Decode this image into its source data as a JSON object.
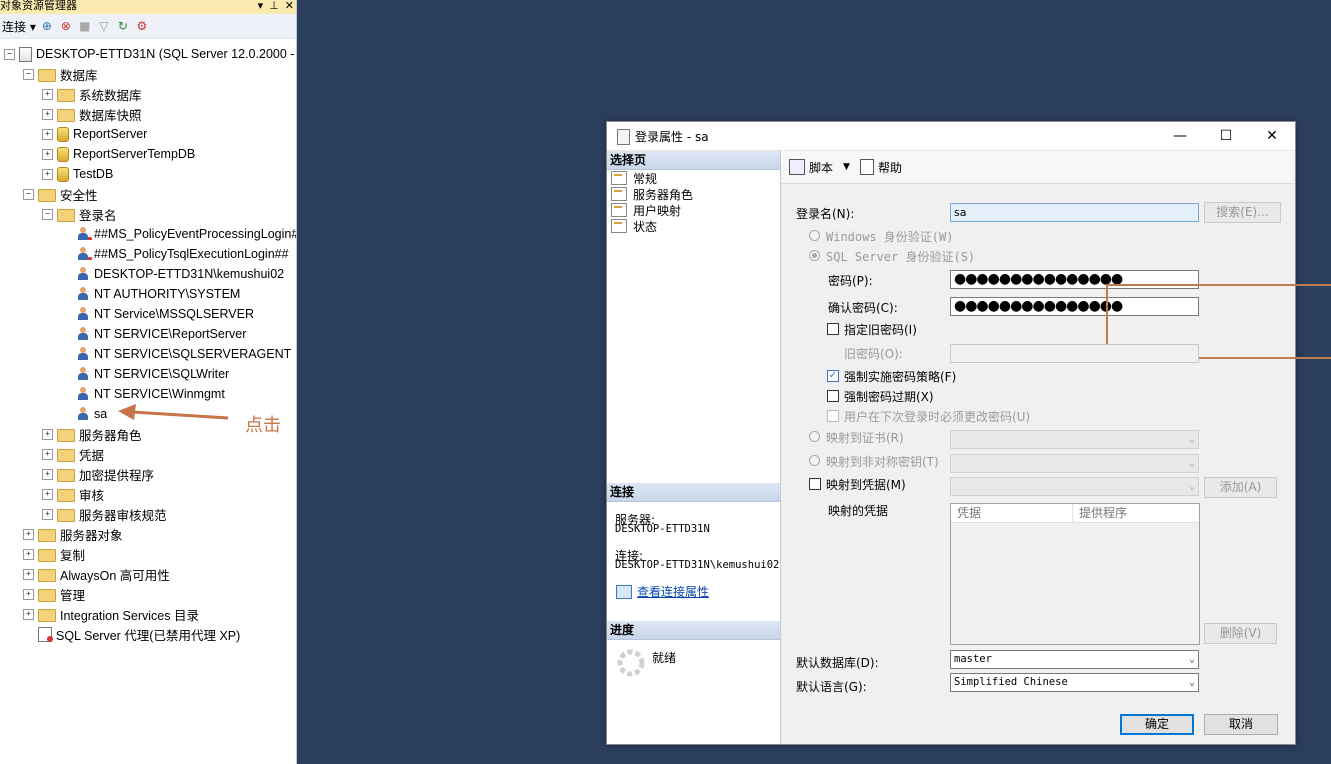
{
  "explorer": {
    "title": "对象资源管理器",
    "title_buttons": [
      "▾",
      "⊥",
      "✕"
    ],
    "toolbar": {
      "connect_label": "连接 ▾"
    },
    "tree": [
      {
        "label": "DESKTOP-ETTD31N (SQL Server 12.0.2000 -",
        "level": 0,
        "expander": "⊟",
        "icon": "server-icon"
      },
      {
        "label": "数据库",
        "level": 1,
        "expander": "⊟",
        "icon": "folder-icon"
      },
      {
        "label": "系统数据库",
        "level": 2,
        "expander": "⊞",
        "icon": "folder-icon"
      },
      {
        "label": "数据库快照",
        "level": 2,
        "expander": "⊞",
        "icon": "folder-icon"
      },
      {
        "label": "ReportServer",
        "level": 2,
        "expander": "⊞",
        "icon": "database-icon"
      },
      {
        "label": "ReportServerTempDB",
        "level": 2,
        "expander": "⊞",
        "icon": "database-icon"
      },
      {
        "label": "TestDB",
        "level": 2,
        "expander": "⊞",
        "icon": "database-icon"
      },
      {
        "label": "安全性",
        "level": 1,
        "expander": "⊟",
        "icon": "folder-icon"
      },
      {
        "label": "登录名",
        "level": 2,
        "expander": "⊟",
        "icon": "folder-icon"
      },
      {
        "label": "##MS_PolicyEventProcessingLogin##",
        "level": 3,
        "expander": "",
        "icon": "login-disabled-icon"
      },
      {
        "label": "##MS_PolicyTsqlExecutionLogin##",
        "level": 3,
        "expander": "",
        "icon": "login-disabled-icon"
      },
      {
        "label": "DESKTOP-ETTD31N\\kemushui02",
        "level": 3,
        "expander": "",
        "icon": "login-icon"
      },
      {
        "label": "NT AUTHORITY\\SYSTEM",
        "level": 3,
        "expander": "",
        "icon": "login-icon"
      },
      {
        "label": "NT Service\\MSSQLSERVER",
        "level": 3,
        "expander": "",
        "icon": "login-icon"
      },
      {
        "label": "NT SERVICE\\ReportServer",
        "level": 3,
        "expander": "",
        "icon": "login-icon"
      },
      {
        "label": "NT SERVICE\\SQLSERVERAGENT",
        "level": 3,
        "expander": "",
        "icon": "login-icon"
      },
      {
        "label": "NT SERVICE\\SQLWriter",
        "level": 3,
        "expander": "",
        "icon": "login-icon"
      },
      {
        "label": "NT SERVICE\\Winmgmt",
        "level": 3,
        "expander": "",
        "icon": "login-icon"
      },
      {
        "label": "sa",
        "level": 3,
        "expander": "",
        "icon": "login-icon"
      },
      {
        "label": "服务器角色",
        "level": 2,
        "expander": "⊞",
        "icon": "folder-icon"
      },
      {
        "label": "凭据",
        "level": 2,
        "expander": "⊞",
        "icon": "folder-icon"
      },
      {
        "label": "加密提供程序",
        "level": 2,
        "expander": "⊞",
        "icon": "folder-icon"
      },
      {
        "label": "审核",
        "level": 2,
        "expander": "⊞",
        "icon": "folder-icon"
      },
      {
        "label": "服务器审核规范",
        "level": 2,
        "expander": "⊞",
        "icon": "folder-icon"
      },
      {
        "label": "服务器对象",
        "level": 1,
        "expander": "⊞",
        "icon": "folder-icon"
      },
      {
        "label": "复制",
        "level": 1,
        "expander": "⊞",
        "icon": "folder-icon"
      },
      {
        "label": "AlwaysOn 高可用性",
        "level": 1,
        "expander": "⊞",
        "icon": "folder-icon"
      },
      {
        "label": "管理",
        "level": 1,
        "expander": "⊞",
        "icon": "folder-icon"
      },
      {
        "label": "Integration Services 目录",
        "level": 1,
        "expander": "⊞",
        "icon": "folder-icon"
      },
      {
        "label": "SQL Server 代理(已禁用代理 XP)",
        "level": 1,
        "expander": "",
        "icon": "agent-icon"
      }
    ]
  },
  "annotation": {
    "text": "点击",
    "color": "#c8744a"
  },
  "dialog": {
    "title": "登录属性 - sa",
    "window_buttons": {
      "minimize": "—",
      "maximize": "☐",
      "close": "✕"
    },
    "left": {
      "select_page_header": "选择页",
      "pages": [
        "常规",
        "服务器角色",
        "用户映射",
        "状态"
      ],
      "connection_header": "连接",
      "server_label": "服务器:",
      "server_value": "DESKTOP-ETTD31N",
      "connection_label": "连接:",
      "connection_value": "DESKTOP-ETTD31N\\kemushui02",
      "view_link": "查看连接属性",
      "progress_header": "进度",
      "progress_status": "就绪"
    },
    "toolbar": {
      "script_label": "脚本",
      "help_label": "帮助"
    },
    "form": {
      "login_name_label": "登录名(N):",
      "login_name_value": "sa",
      "search_button": "搜索(E)...",
      "windows_auth": "Windows 身份验证(W)",
      "sql_auth": "SQL Server 身份验证(S)",
      "password_label": "密码(P):",
      "password_value": "●●●●●●●●●●●●●●●",
      "confirm_label": "确认密码(C):",
      "confirm_value": "●●●●●●●●●●●●●●●",
      "specify_old": "指定旧密码(I)",
      "old_password_label": "旧密码(O):",
      "enforce_policy": "强制实施密码策略(F)",
      "enforce_expiry": "强制密码过期(X)",
      "must_change": "用户在下次登录时必须更改密码(U)",
      "map_cert": "映射到证书(R)",
      "map_asym": "映射到非对称密钥(T)",
      "map_credential": "映射到凭据(M)",
      "add_button": "添加(A)",
      "mapped_credentials_label": "映射的凭据",
      "col_credential": "凭据",
      "col_provider": "提供程序",
      "remove_button": "删除(V)",
      "default_db_label": "默认数据库(D):",
      "default_db_value": "master",
      "default_lang_label": "默认语言(G):",
      "default_lang_value": "Simplified Chinese"
    },
    "ok_button": "确定",
    "cancel_button": "取消"
  }
}
